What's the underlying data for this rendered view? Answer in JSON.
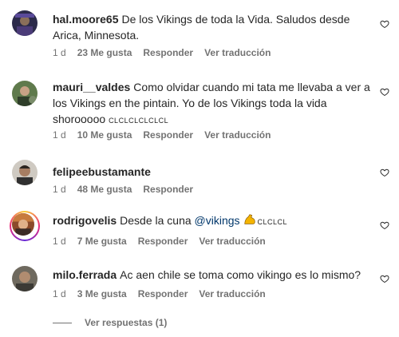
{
  "comments": [
    {
      "username": "hal.moore65",
      "text": "De los Vikings de toda la Vida. Saludos desde Arica, Minnesota.",
      "time": "1 d",
      "likes": "23 Me gusta",
      "reply": "Responder",
      "translate": "Ver traducción"
    },
    {
      "username": "mauri__valdes",
      "text": "Como olvidar cuando mi tata me llevaba a ver a los Vikings en the pintain. Yo de los Vikings toda la vida shorooooo",
      "text_suffix": "CLCLCLCLCLCL",
      "time": "1 d",
      "likes": "10 Me gusta",
      "reply": "Responder",
      "translate": "Ver traducción"
    },
    {
      "username": "felipeebustamante",
      "text": "",
      "time": "1 d",
      "likes": "48 Me gusta",
      "reply": "Responder"
    },
    {
      "username": "rodrigovelis",
      "text": "Desde la cuna",
      "mention": "@vikings",
      "emoji": "flexed-biceps",
      "text_suffix": "CLCLCL",
      "time": "1 d",
      "likes": "7 Me gusta",
      "reply": "Responder",
      "translate": "Ver traducción"
    },
    {
      "username": "milo.ferrada",
      "text": "Ac aen chile se toma como vikingo es lo mismo?",
      "time": "1 d",
      "likes": "3 Me gusta",
      "reply": "Responder",
      "translate": "Ver traducción"
    }
  ],
  "replies_label": "Ver respuestas (1)",
  "icons": {
    "like": "heart-outline-icon"
  }
}
